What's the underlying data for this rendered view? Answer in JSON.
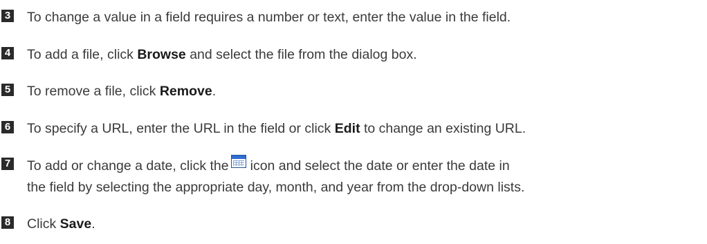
{
  "steps": [
    {
      "number": "3",
      "parts": [
        "To change a value in a field requires a number or text, enter the value in the field."
      ]
    },
    {
      "number": "4",
      "parts": [
        "To add a file, click ",
        "Browse",
        " and select the file from the dialog box."
      ]
    },
    {
      "number": "5",
      "parts": [
        "To remove a file, click ",
        "Remove",
        "."
      ]
    },
    {
      "number": "6",
      "parts": [
        "To specify a URL, enter the URL in the field or click ",
        "Edit",
        " to change an existing URL."
      ]
    },
    {
      "number": "7",
      "parts": [
        "To add or change a date, click the",
        "icon and select the date or enter the date in",
        "the field by selecting the appropriate day, month, and year from the drop-down lists."
      ],
      "icon": "calendar-icon"
    },
    {
      "number": "8",
      "parts": [
        "Click ",
        "Save",
        "."
      ]
    }
  ]
}
